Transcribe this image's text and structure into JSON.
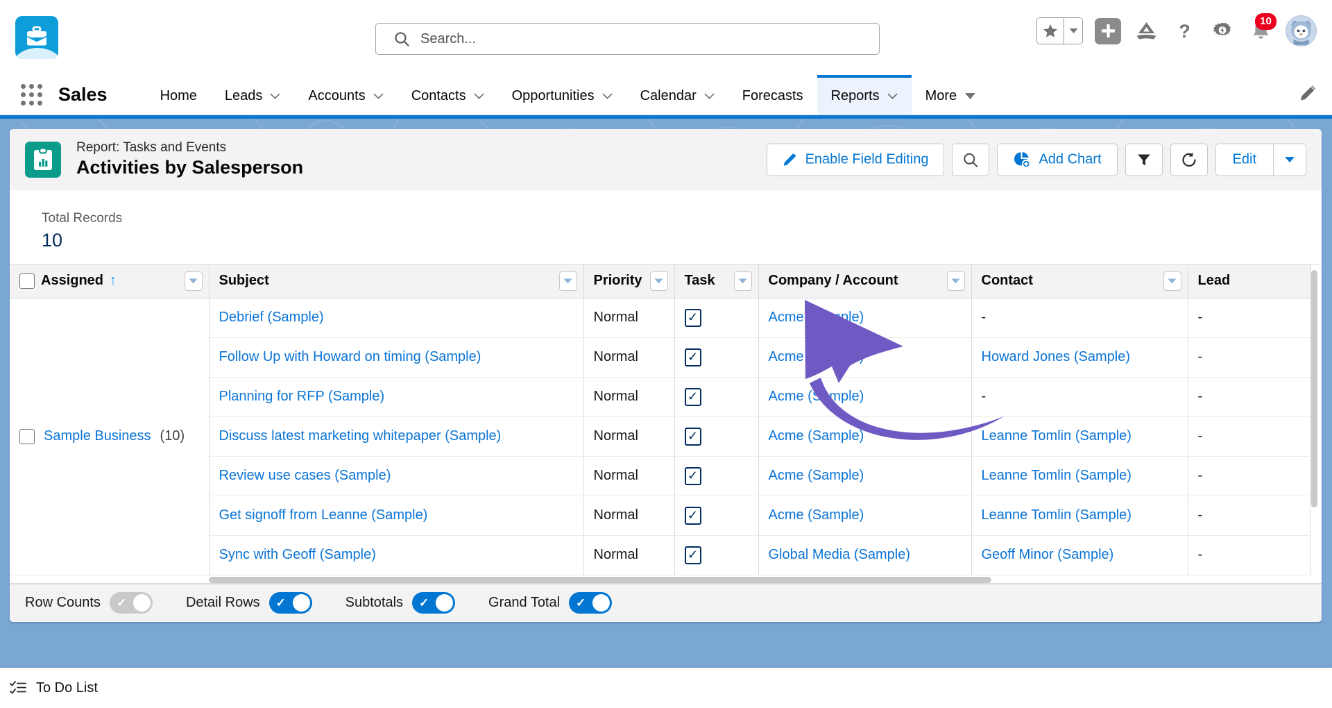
{
  "header": {
    "logo_icon": "briefcase-cloud-logo",
    "search": {
      "placeholder": "Search...",
      "value": "",
      "icon": "search-icon"
    },
    "actions": {
      "favorites_icon": "star-icon",
      "favorites_dropdown_icon": "chevron-down-icon",
      "add_icon": "plus-icon",
      "trailhead_icon": "mountain-icon",
      "help_icon": "question-mark-icon",
      "setup_icon": "gear-lightning-icon",
      "notifications_icon": "bell-icon",
      "notifications_count": "10",
      "avatar_icon": "astro-avatar"
    }
  },
  "nav": {
    "waffle_icon": "app-launcher-icon",
    "app_name": "Sales",
    "edit_icon": "pencil-icon",
    "items": [
      {
        "label": "Home",
        "has_dropdown": false,
        "active": false
      },
      {
        "label": "Leads",
        "has_dropdown": true,
        "active": false
      },
      {
        "label": "Accounts",
        "has_dropdown": true,
        "active": false
      },
      {
        "label": "Contacts",
        "has_dropdown": true,
        "active": false
      },
      {
        "label": "Opportunities",
        "has_dropdown": true,
        "active": false
      },
      {
        "label": "Calendar",
        "has_dropdown": true,
        "active": false
      },
      {
        "label": "Forecasts",
        "has_dropdown": false,
        "active": false
      },
      {
        "label": "Reports",
        "has_dropdown": true,
        "active": true
      },
      {
        "label": "More",
        "has_dropdown": true,
        "active": false
      }
    ]
  },
  "report": {
    "icon": "report-clipboard-icon",
    "eyebrow": "Report: Tasks and Events",
    "title": "Activities by Salesperson",
    "actions": {
      "enable_field_editing": "Enable Field Editing",
      "enable_field_editing_icon": "pencil-icon",
      "search_icon": "search-icon",
      "add_chart": "Add Chart",
      "add_chart_icon": "pie-chart-icon",
      "filter_icon": "funnel-icon",
      "refresh_icon": "refresh-icon",
      "edit": "Edit",
      "edit_dropdown_icon": "chevron-down-icon"
    },
    "totals": {
      "label": "Total Records",
      "value": "10"
    }
  },
  "table": {
    "columns": [
      {
        "label": "Assigned",
        "sort": "asc",
        "has_checkbox": true,
        "has_dropdown": true
      },
      {
        "label": "Subject",
        "has_dropdown": true
      },
      {
        "label": "Priority",
        "has_dropdown": true
      },
      {
        "label": "Task",
        "has_dropdown": true
      },
      {
        "label": "Company / Account",
        "has_dropdown": true
      },
      {
        "label": "Contact",
        "has_dropdown": true
      },
      {
        "label": "Lead",
        "has_dropdown": false
      }
    ],
    "group": {
      "label": "Sample Business",
      "count": "(10)"
    },
    "rows": [
      {
        "subject": "Debrief (Sample)",
        "priority": "Normal",
        "task": true,
        "company": "Acme (Sample)",
        "contact": "-",
        "contact_is_link": false,
        "lead": "-"
      },
      {
        "subject": "Follow Up with Howard on timing (Sample)",
        "priority": "Normal",
        "task": true,
        "company": "Acme (Sample)",
        "contact": "Howard Jones (Sample)",
        "contact_is_link": true,
        "lead": "-"
      },
      {
        "subject": "Planning for RFP (Sample)",
        "priority": "Normal",
        "task": true,
        "company": "Acme (Sample)",
        "contact": "-",
        "contact_is_link": false,
        "lead": "-"
      },
      {
        "subject": "Discuss latest marketing whitepaper (Sample)",
        "priority": "Normal",
        "task": true,
        "company": "Acme (Sample)",
        "contact": "Leanne Tomlin (Sample)",
        "contact_is_link": true,
        "lead": "-"
      },
      {
        "subject": "Review use cases (Sample)",
        "priority": "Normal",
        "task": true,
        "company": "Acme (Sample)",
        "contact": "Leanne Tomlin (Sample)",
        "contact_is_link": true,
        "lead": "-"
      },
      {
        "subject": "Get signoff from Leanne (Sample)",
        "priority": "Normal",
        "task": true,
        "company": "Acme (Sample)",
        "contact": "Leanne Tomlin (Sample)",
        "contact_is_link": true,
        "lead": "-"
      },
      {
        "subject": "Sync with Geoff (Sample)",
        "priority": "Normal",
        "task": true,
        "company": "Global Media (Sample)",
        "contact": "Geoff Minor (Sample)",
        "contact_is_link": true,
        "lead": "-"
      }
    ]
  },
  "footer_toggles": [
    {
      "label": "Row Counts",
      "on": false
    },
    {
      "label": "Detail Rows",
      "on": true
    },
    {
      "label": "Subtotals",
      "on": true
    },
    {
      "label": "Grand Total",
      "on": true
    }
  ],
  "utility_bar": {
    "items": [
      {
        "label": "To Do List",
        "icon": "checklist-icon"
      }
    ]
  },
  "annotation": {
    "type": "curved-arrow",
    "color": "#6f5ac4",
    "points_to": "Add Chart"
  },
  "colors": {
    "brand_blue": "#0176d3",
    "link_blue": "#0b74d6",
    "report_icon_teal": "#0b9b8a",
    "badge_red": "#ea001e",
    "annotation_purple": "#6f5ac4"
  }
}
